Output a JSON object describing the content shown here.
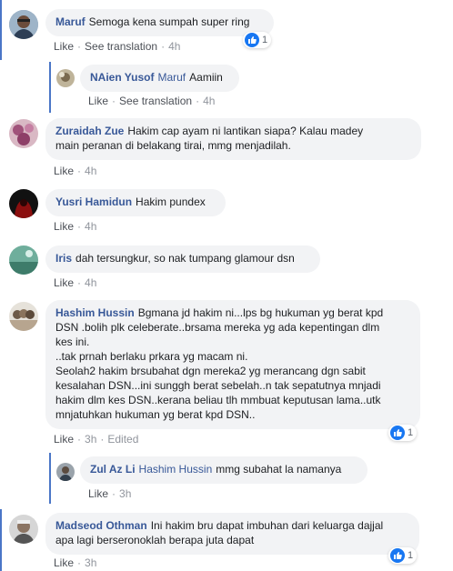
{
  "comments": [
    {
      "author": "Maruf",
      "text": "Semoga kena sumpah super ring",
      "like": "Like",
      "translate": "See translation",
      "time": "4h",
      "reactions": "1"
    },
    {
      "author": "NAien Yusof",
      "mention": "Maruf",
      "text": "Aamiin",
      "like": "Like",
      "translate": "See translation",
      "time": "4h"
    },
    {
      "author": "Zuraidah Zue",
      "text": "Hakim cap ayam ni lantikan siapa? Kalau madey\nmain peranan di belakang tirai, mmg menjadilah.",
      "like": "Like",
      "time": "4h"
    },
    {
      "author": "Yusri Hamidun",
      "text": "Hakim pundex",
      "like": "Like",
      "time": "4h"
    },
    {
      "author": "Iris",
      "text": "dah tersungkur, so nak tumpang glamour dsn",
      "like": "Like",
      "time": "4h"
    },
    {
      "author": "Hashim Hussin",
      "text": "Bgmana jd hakim ni...lps bg hukuman yg berat kpd\nDSN .bolih plk celeberate..brsama mereka yg ada kepentingan dlm\nkes ini.\n..tak prnah berlaku prkara yg macam ni.\nSeolah2 hakim brsubahat dgn mereka2 yg merancang dgn sabit\nkesalahan DSN...ini sunggh berat sebelah..n tak sepatutnya mnjadi\nhakim dlm kes DSN..kerana beliau tlh mmbuat keputusan lama..utk\nmnjatuhkan hukuman yg berat kpd DSN..",
      "like": "Like",
      "time": "3h",
      "edited": "Edited",
      "reactions": "1"
    },
    {
      "author": "Zul Az Li",
      "mention": "Hashim Hussin",
      "text": "mmg subahat la namanya",
      "like": "Like",
      "time": "3h"
    },
    {
      "author": "Madseod Othman",
      "text": "Ini hakim bru dapat imbuhan dari keluarga dajjal\napa lagi berseronoklah berapa juta dapat",
      "like": "Like",
      "time": "3h",
      "reactions": "1"
    }
  ],
  "colors": {
    "link": "#385898",
    "bubble": "#f2f3f5",
    "like_blue": "#1877f2",
    "thread_line": "#4a76c7"
  }
}
